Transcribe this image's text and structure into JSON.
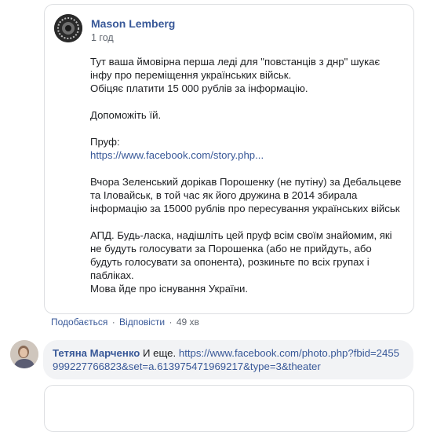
{
  "post": {
    "author": "Mason Lemberg",
    "time": "1 год",
    "paragraphs": [
      "Тут ваша ймовірна перша леді для \"повстанців з днр\" шукає\nінфу про переміщення українських військ.\nОбіцяє платити 15 000 рублів за інформацію.",
      "Допоможіть їй.",
      "Вчора Зеленський дорікав Порошенку (не путіну) за Дебальцеве\nта Іловайськ, в той час як його дружина в 2014 збирала\nінформацію за 15000 рублів про пересування українських військ",
      "АПД. Будь-ласка, надішліть цей пруф всім своїм знайомим, які\nне будуть голосувати за Порошенка (або не прийдуть, або\nбудуть голосувати за опонента), розкиньте по всіх групах і\nпабліках.\nМова йде про існування України."
    ],
    "proof_label": "Пруф:",
    "proof_link": "https://www.facebook.com/story.php..."
  },
  "actions": {
    "like": "Подобається",
    "reply": "Відповісти",
    "ago": "49 хв",
    "separator": "·"
  },
  "comment": {
    "author": "Тетяна Марченко",
    "text": "И еще.",
    "link": "https://www.facebook.com/photo.php?fbid=2455999227766823&set=a.613975471969217&type=3&theater"
  },
  "colors": {
    "link": "#385898",
    "muted": "#616770",
    "bubble": "#f2f3f5",
    "border": "#dddfe2"
  }
}
